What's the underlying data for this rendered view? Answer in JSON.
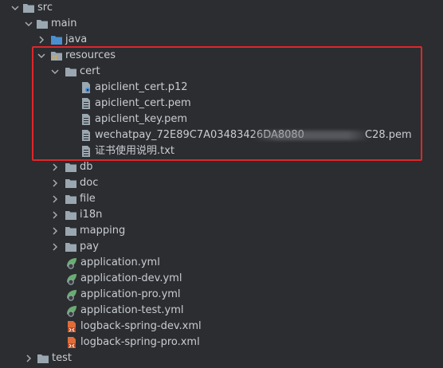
{
  "tree": {
    "src": "src",
    "main": "main",
    "java": "java",
    "resources": "resources",
    "cert": "cert",
    "cert_files": [
      "apiclient_cert.p12",
      "apiclient_cert.pem",
      "apiclient_key.pem"
    ],
    "wechatpay_prefix": "wechatpay_72E89C7A03483426DA8080",
    "wechatpay_suffix": "C28.pem",
    "readme": "证书使用说明.txt",
    "dirs": [
      "db",
      "doc",
      "file",
      "i18n",
      "mapping",
      "pay"
    ],
    "yml_files": [
      "application.yml",
      "application-dev.yml",
      "application-pro.yml",
      "application-test.yml"
    ],
    "xml_files": [
      "logback-spring-dev.xml",
      "logback-spring-pro.xml"
    ],
    "test": "test"
  },
  "colors": {
    "background": "#2b2d30",
    "text": "#c9ccd2",
    "folder": "#9aa7b0",
    "java_folder": "#4a8fd0",
    "highlight_border": "#e0262a",
    "spring_leaf": "#6aab73",
    "xml_icon": "#e06c3a"
  }
}
